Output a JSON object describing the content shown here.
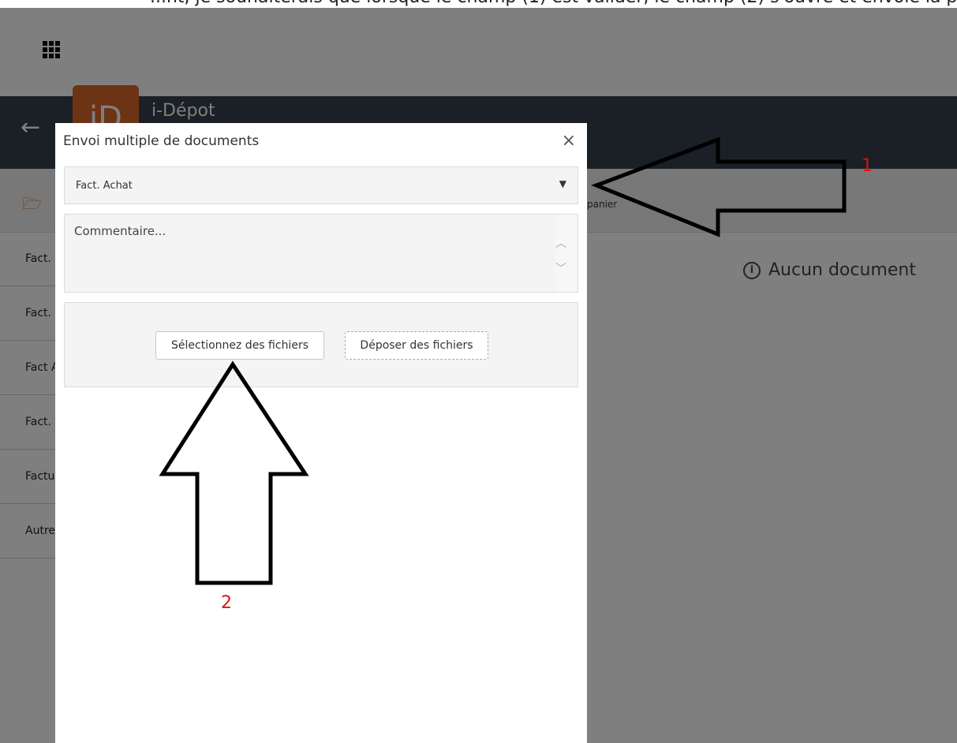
{
  "caption": "...nt, je souhaiterais que lorsque le champ (1) est valider, le champ (2) s'ouvre et envoie la pièce",
  "app": {
    "title": "i-Dépot",
    "logo_text": "iD",
    "brand_color": "#d9662a",
    "header_color": "#34414a",
    "panier_text": "panier",
    "empty_message": "Aucun document",
    "side_items": [
      "Fact.",
      "Fact.",
      "Fact A",
      "Fact.",
      "Factu",
      "Autre"
    ]
  },
  "modal": {
    "title": "Envoi multiple de documents",
    "close_glyph": "×",
    "select_value": "Fact. Achat",
    "comment_placeholder": "Commentaire...",
    "select_files_label": "Sélectionnez des fichiers",
    "drop_files_label": "Déposer des fichiers"
  },
  "annotations": {
    "label_1": "1",
    "label_2": "2"
  }
}
